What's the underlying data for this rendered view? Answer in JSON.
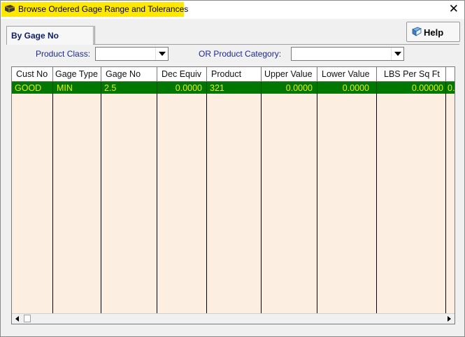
{
  "window": {
    "title": "Browse Ordered Gage Range and Tolerances",
    "close_glyph": "✕"
  },
  "tabs": [
    {
      "label": "By Gage No",
      "active": true
    }
  ],
  "help_button": {
    "label": "Help",
    "icon": "help-book-icon"
  },
  "filters": {
    "product_class_label": "Product Class:",
    "product_class_value": "",
    "product_category_label": "OR Product Category:",
    "product_category_value": ""
  },
  "grid": {
    "columns": [
      "Cust No",
      "Gage Type",
      "Gage No",
      "Dec Equiv",
      "Product",
      "Upper Value",
      "Lower Value",
      "LBS Per Sq Ft",
      ""
    ],
    "rows": [
      {
        "cust_no": "GOOD",
        "gage_type": "MIN",
        "gage_no": "2.5",
        "dec_equiv": "0.0000",
        "product": "321",
        "upper_value": "0.0000",
        "lower_value": "0.0000",
        "lbs_per_sq_ft": "0.00000",
        "extra": "0."
      }
    ],
    "selected_row_color": "#007800",
    "selected_text_color": "#e8f000",
    "body_background": "#fdeee2"
  },
  "colors": {
    "title_highlight": "#ffe800",
    "label_blue": "#1a2a90"
  }
}
